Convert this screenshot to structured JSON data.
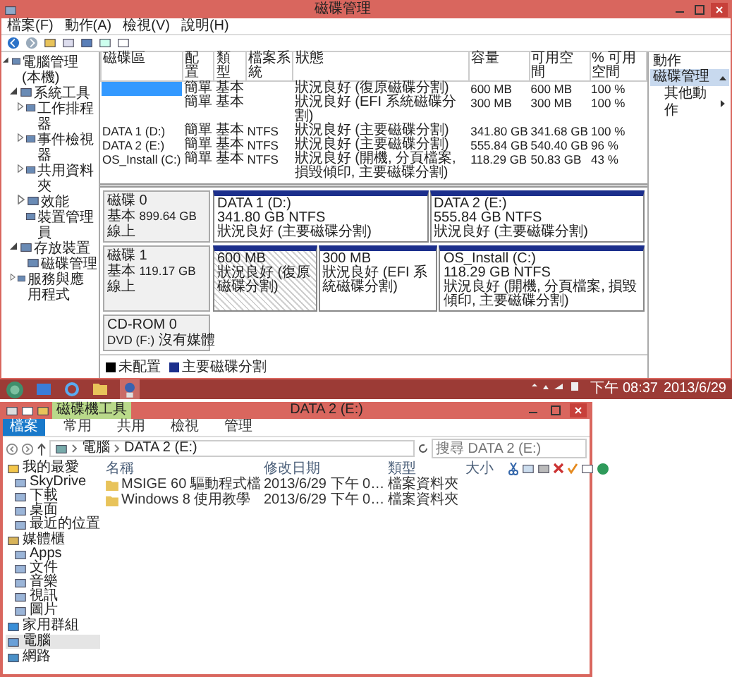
{
  "disk_management": {
    "title": "磁碟管理",
    "menu": [
      "檔案(F)",
      "動作(A)",
      "檢視(V)",
      "說明(H)"
    ],
    "tree": [
      {
        "label": "電腦管理 (本機)",
        "expanded": true,
        "children": [
          {
            "label": "系統工具",
            "expanded": true,
            "children": [
              {
                "label": "工作排程器",
                "expanded": false
              },
              {
                "label": "事件檢視器",
                "expanded": false
              },
              {
                "label": "共用資料夾",
                "expanded": false
              },
              {
                "label": "效能",
                "expanded": false
              },
              {
                "label": "裝置管理員"
              }
            ]
          },
          {
            "label": "存放裝置",
            "expanded": true,
            "children": [
              {
                "label": "磁碟管理"
              }
            ]
          },
          {
            "label": "服務與應用程式",
            "expanded": false
          }
        ]
      }
    ],
    "volume_table": {
      "columns": [
        "磁碟區",
        "配置",
        "類型",
        "檔案系統",
        "狀態",
        "容量",
        "可用空間",
        "% 可用空間"
      ],
      "rows": [
        {
          "selected": true,
          "layout": "簡單",
          "type": "基本",
          "status": "狀況良好 (復原磁碟分割)",
          "capacity": "600 MB",
          "free": "600 MB",
          "percent": "100 %"
        },
        {
          "selected": false,
          "layout": "簡單",
          "type": "基本",
          "status": "狀況良好 (EFI 系統磁碟分割)",
          "capacity": "300 MB",
          "free": "300 MB",
          "percent": "100 %"
        },
        {
          "selected": false,
          "volume": "DATA 1 (D:)",
          "layout": "簡單",
          "type": "基本",
          "file_system": "NTFS",
          "status": "狀況良好 (主要磁碟分割)",
          "capacity": "341.80 GB",
          "free": "341.68 GB",
          "percent": "100 %"
        },
        {
          "selected": false,
          "volume": "DATA 2 (E:)",
          "layout": "簡單",
          "type": "基本",
          "file_system": "NTFS",
          "status": "狀況良好 (主要磁碟分割)",
          "capacity": "555.84 GB",
          "free": "540.40 GB",
          "percent": "96 %"
        },
        {
          "selected": false,
          "volume": "OS_Install (C:)",
          "layout": "簡單",
          "type": "基本",
          "file_system": "NTFS",
          "status": "狀況良好 (開機, 分頁檔案, 損毀傾印, 主要磁碟分割)",
          "capacity": "118.29 GB",
          "free": "50.83 GB",
          "percent": "43 %"
        }
      ]
    },
    "actions": {
      "title": "動作",
      "items": [
        {
          "kind": "header",
          "label": "磁碟管理"
        },
        {
          "kind": "item",
          "label": "其他動作"
        }
      ]
    },
    "disks": [
      {
        "kind": "disk",
        "name": "磁碟 0",
        "type": "基本",
        "size": "899.64 GB",
        "status": "線上",
        "partitions": [
          {
            "name": "DATA 1 (D:)",
            "size": "341.80 GB NTFS",
            "status": "狀況良好 (主要磁碟分割)",
            "selected": false
          },
          {
            "name": "DATA 2 (E:)",
            "size": "555.84 GB NTFS",
            "status": "狀況良好 (主要磁碟分割)",
            "selected": false
          }
        ]
      },
      {
        "kind": "disk",
        "name": "磁碟 1",
        "type": "基本",
        "size": "119.17 GB",
        "status": "線上",
        "partitions": [
          {
            "size": "600 MB",
            "status": "狀況良好 (復原磁碟分割)",
            "selected": true
          },
          {
            "size": "300 MB",
            "status": "狀況良好 (EFI 系統磁碟分割)",
            "selected": false
          },
          {
            "name": "OS_Install (C:)",
            "size": "118.29 GB NTFS",
            "status": "狀況良好 (開機, 分頁檔案, 損毀傾印, 主要磁碟分割)",
            "selected": false
          }
        ]
      },
      {
        "kind": "cdrom",
        "name": "CD-ROM 0",
        "type": "DVD (F:)",
        "status": "沒有媒體"
      }
    ],
    "legend": [
      {
        "label": "未配置",
        "color": "#000000"
      },
      {
        "label": "主要磁碟分割",
        "color": "#1c2f8c"
      }
    ]
  },
  "taskbar": {
    "time": "下午 08:37",
    "date": "2013/6/29"
  },
  "explorer": {
    "title": "DATA 2 (E:)",
    "context_tab": "磁碟機工具",
    "ribbon_tabs": [
      {
        "kind": "file",
        "label": "檔案"
      },
      {
        "kind": "tab",
        "label": "常用"
      },
      {
        "kind": "tab",
        "label": "共用"
      },
      {
        "kind": "tab",
        "label": "檢視"
      },
      {
        "kind": "tab",
        "label": "管理"
      }
    ],
    "address": [
      "電腦",
      "DATA 2 (E:)"
    ],
    "search": {
      "placeholder": "搜尋 DATA 2 (E:)"
    },
    "columns": [
      "名稱",
      "修改日期",
      "類型",
      "大小"
    ],
    "files": [
      {
        "name": "MSIGE 60 驅動程式檔",
        "modified": "2013/6/29 下午 0…",
        "type": "檔案資料夾"
      },
      {
        "name": "Windows 8 使用教學",
        "modified": "2013/6/29 下午 0…",
        "type": "檔案資料夾"
      }
    ],
    "nav": [
      {
        "label": "我的最愛",
        "selected": false,
        "children": [
          "SkyDrive",
          "下載",
          "桌面",
          "最近的位置"
        ]
      },
      {
        "label": "媒體櫃",
        "selected": false,
        "children": [
          "Apps",
          "文件",
          "音樂",
          "視訊",
          "圖片"
        ]
      },
      {
        "label": "家用群組",
        "selected": false
      },
      {
        "label": "電腦",
        "selected": true
      },
      {
        "label": "網路",
        "selected": false
      }
    ]
  }
}
